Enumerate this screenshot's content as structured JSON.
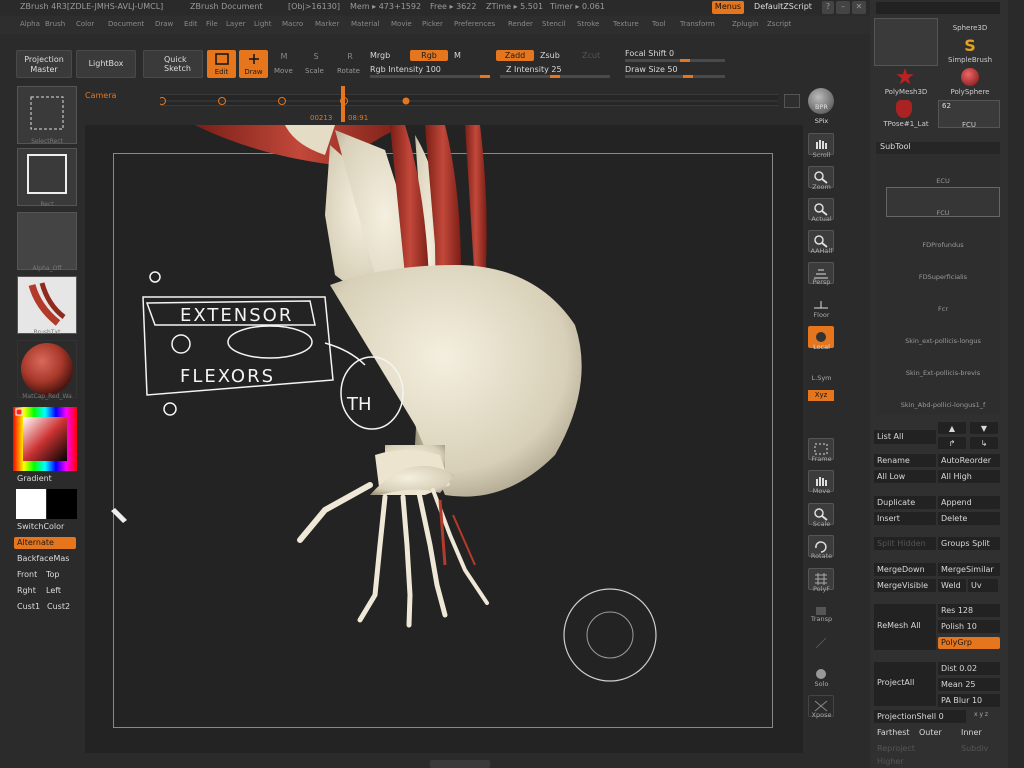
{
  "titlebar": {
    "app": "ZBrush 4R3[ZDLE-JMHS-AVLJ-UMCL]",
    "doc": "ZBrush Document",
    "obj": "[Obj>16130]",
    "mem": "Mem ▸ 473+1592",
    "free": "Free ▸ 3622",
    "ztime": "ZTime ▸ 5.501",
    "timer": "Timer ▸ 0.061",
    "menus_btn": "Menus",
    "script_btn": "DefaultZScript"
  },
  "menubar": {
    "items": [
      "Alpha",
      "Brush",
      "Color",
      "Document",
      "Draw",
      "Edit",
      "File",
      "Layer",
      "Light",
      "Macro",
      "Marker",
      "Material",
      "Movie",
      "Picker",
      "Preferences",
      "Render",
      "Stencil",
      "Stroke",
      "Texture",
      "Tool",
      "Transform",
      "Zplugin",
      "Zscript"
    ]
  },
  "toolbar": {
    "projection_master": "Projection Master",
    "lightbox": "LightBox",
    "quick_sketch": "Quick Sketch",
    "edit": "Edit",
    "draw": "Draw",
    "move": "Move",
    "scale": "Scale",
    "rotate": "Rotate",
    "mrgb": "Mrgb",
    "rgb": "Rgb",
    "m": "M",
    "rgb_intensity": "Rgb Intensity 100",
    "zadd": "Zadd",
    "zsub": "Zsub",
    "zcut": "Zcut",
    "z_intensity": "Z Intensity 25",
    "focal_shift": "Focal Shift 0",
    "draw_size": "Draw Size 50"
  },
  "timeline": {
    "label": "Camera",
    "frame": "00213",
    "time": "08:91"
  },
  "lefttray": {
    "select_rect": "SelectRect",
    "rect": "Rect",
    "alpha_off": "Alpha_Off",
    "brush_txt": "BrushTxt",
    "matcap": "MatCap_Red_Wa",
    "gradient": "Gradient",
    "switch_color": "SwitchColor",
    "alternate": "Alternate",
    "backface": "BackfaceMas",
    "front": "Front",
    "top": "Top",
    "right": "Rght",
    "left": "Left",
    "cust1": "Cust1",
    "cust2": "Cust2"
  },
  "sketch": {
    "word1": "EXTENSOR",
    "word2": "FLEXORS",
    "circle_label": "TH"
  },
  "rightshelf": [
    "BPR",
    "SPix",
    "Scroll",
    "Zoom",
    "Actual",
    "AAHalf",
    "Persp",
    "Floor",
    "Local",
    "L.Sym",
    "Xyz",
    "Frame",
    "Move",
    "Scale",
    "Rotate",
    "PolyF",
    "Transp",
    "Ghost",
    "Solo",
    "Xpose"
  ],
  "toolpanel": {
    "thumbs": [
      "Sphere3D",
      "SimpleBrush",
      "PolyMesh3D",
      "PolySphere",
      "TPose#1_Lat",
      "FCU"
    ],
    "count": "62",
    "subtool_title": "SubTool",
    "subtools": [
      "ECU",
      "FCU",
      "FDProfundus",
      "FDSuperficialis",
      "Fcr",
      "Skin_ext-pollicis-longus",
      "Skin_Ext-pollicis-brevis",
      "Skin_Abd-pollici-longus1_f"
    ],
    "list_all": "List All",
    "rename": "Rename",
    "auto_reorder": "AutoReorder",
    "all_low": "All Low",
    "all_high": "All High",
    "duplicate": "Duplicate",
    "append": "Append",
    "insert": "Insert",
    "delete": "Delete",
    "split_hidden": "Split Hidden",
    "groups_split": "Groups Split",
    "merge_down": "MergeDown",
    "merge_similar": "MergeSimilar",
    "merge_visible": "MergeVisible",
    "weld": "Weld",
    "uv": "Uv",
    "remesh_all": "ReMesh All",
    "res": "Res 128",
    "polish": "Polish 10",
    "polygrp": "PolyGrp",
    "project_all": "ProjectAll",
    "dist": "Dist 0.02",
    "mean": "Mean 25",
    "pa_blur": "PA Blur 10",
    "projection_shell": "ProjectionShell 0",
    "xyz": "x y z",
    "farthest": "Farthest",
    "outer": "Outer",
    "inner": "Inner",
    "reproject_higher": "Reproject Higher",
    "subdiv": "Subdiv"
  },
  "colors": {
    "accent": "#e5761e",
    "bg": "#2b2b2b",
    "canvas": "#232323"
  }
}
